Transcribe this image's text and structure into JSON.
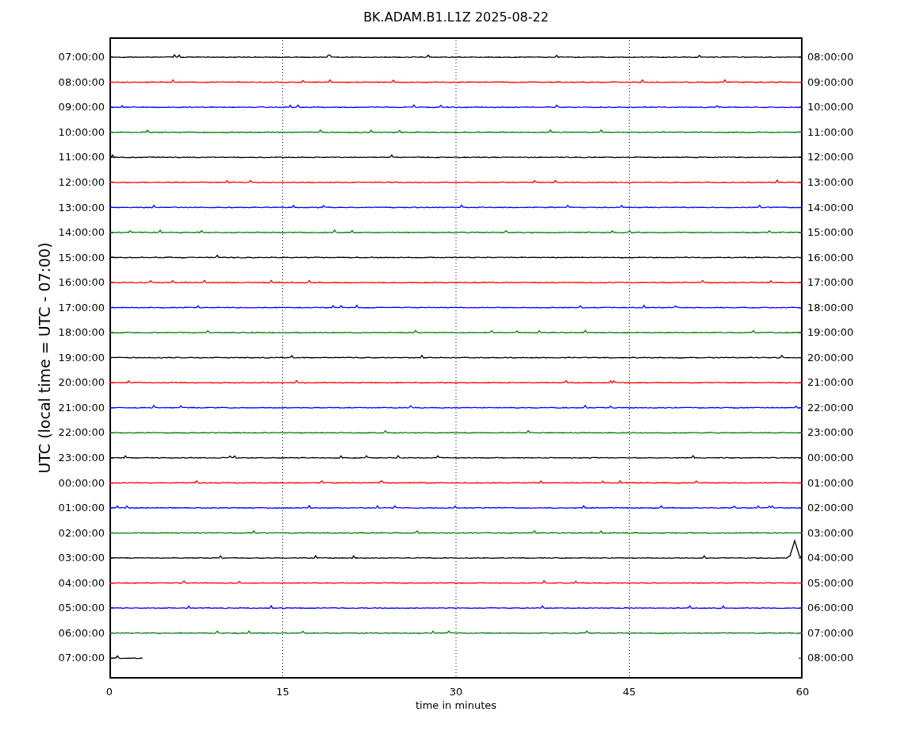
{
  "title": "BK.ADAM.B1.L1Z 2025-08-22",
  "ylabel": "UTC (local time = UTC - 07:00)",
  "xlabel": "time in minutes",
  "xticks": [
    "0",
    "15",
    "30",
    "45",
    "60"
  ],
  "traces": [
    {
      "left": "07:00:00",
      "right": "08:00:00",
      "color": "#000000",
      "kind": "full"
    },
    {
      "left": "08:00:00",
      "right": "09:00:00",
      "color": "#ff0000",
      "kind": "full"
    },
    {
      "left": "09:00:00",
      "right": "10:00:00",
      "color": "#0000ff",
      "kind": "full"
    },
    {
      "left": "10:00:00",
      "right": "11:00:00",
      "color": "#008000",
      "kind": "full"
    },
    {
      "left": "11:00:00",
      "right": "12:00:00",
      "color": "#000000",
      "kind": "full"
    },
    {
      "left": "12:00:00",
      "right": "13:00:00",
      "color": "#ff0000",
      "kind": "full"
    },
    {
      "left": "13:00:00",
      "right": "14:00:00",
      "color": "#0000ff",
      "kind": "full"
    },
    {
      "left": "14:00:00",
      "right": "15:00:00",
      "color": "#008000",
      "kind": "full"
    },
    {
      "left": "15:00:00",
      "right": "16:00:00",
      "color": "#000000",
      "kind": "full"
    },
    {
      "left": "16:00:00",
      "right": "17:00:00",
      "color": "#ff0000",
      "kind": "full"
    },
    {
      "left": "17:00:00",
      "right": "18:00:00",
      "color": "#0000ff",
      "kind": "full"
    },
    {
      "left": "18:00:00",
      "right": "19:00:00",
      "color": "#008000",
      "kind": "full"
    },
    {
      "left": "19:00:00",
      "right": "20:00:00",
      "color": "#000000",
      "kind": "full"
    },
    {
      "left": "20:00:00",
      "right": "21:00:00",
      "color": "#ff0000",
      "kind": "full"
    },
    {
      "left": "21:00:00",
      "right": "22:00:00",
      "color": "#0000ff",
      "kind": "full"
    },
    {
      "left": "22:00:00",
      "right": "23:00:00",
      "color": "#008000",
      "kind": "full"
    },
    {
      "left": "23:00:00",
      "right": "00:00:00",
      "color": "#000000",
      "kind": "full"
    },
    {
      "left": "00:00:00",
      "right": "01:00:00",
      "color": "#ff0000",
      "kind": "full"
    },
    {
      "left": "01:00:00",
      "right": "02:00:00",
      "color": "#0000ff",
      "kind": "full"
    },
    {
      "left": "02:00:00",
      "right": "03:00:00",
      "color": "#008000",
      "kind": "full"
    },
    {
      "left": "03:00:00",
      "right": "04:00:00",
      "color": "#000000",
      "kind": "burst"
    },
    {
      "left": "04:00:00",
      "right": "05:00:00",
      "color": "#ff0000",
      "kind": "full"
    },
    {
      "left": "05:00:00",
      "right": "06:00:00",
      "color": "#0000ff",
      "kind": "full"
    },
    {
      "left": "06:00:00",
      "right": "07:00:00",
      "color": "#008000",
      "kind": "full"
    },
    {
      "left": "07:00:00",
      "right": "08:00:00",
      "color": "#000000",
      "kind": "partial"
    }
  ]
}
